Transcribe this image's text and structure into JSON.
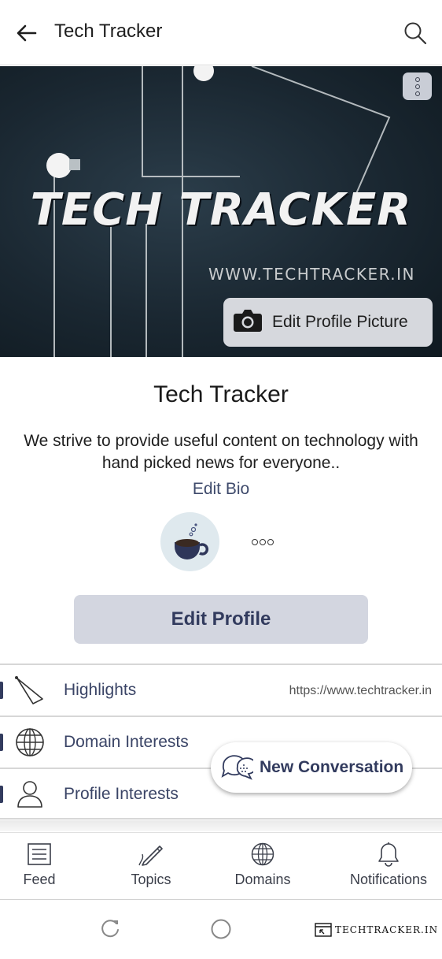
{
  "appbar": {
    "title": "Tech Tracker"
  },
  "banner": {
    "logo_text": "TECH TRACKER",
    "url_text": "WWW.TECHTRACKER.IN",
    "edit_picture_label": "Edit Profile Picture"
  },
  "profile": {
    "name": "Tech Tracker",
    "bio_line1": "We strive to provide useful content on technology with",
    "bio_line2": "hand picked news for everyone..",
    "edit_bio": "Edit Bio",
    "edit_profile": "Edit Profile"
  },
  "list": {
    "highlights": "Highlights",
    "highlights_link": "https://www.techtracker.in",
    "domain_interests": "Domain Interests",
    "profile_interests": "Profile Interests"
  },
  "fab": {
    "label": "New Conversation"
  },
  "bottom_nav": [
    {
      "label": "Feed",
      "icon": "feed-icon"
    },
    {
      "label": "Topics",
      "icon": "pencil-icon"
    },
    {
      "label": "Domains",
      "icon": "globe-icon"
    },
    {
      "label": "Notifications",
      "icon": "bell-icon"
    }
  ],
  "watermark": {
    "text": "TECHTRACKER.IN"
  },
  "colors": {
    "accent": "#323b5e",
    "button_bg": "#d3d6e0",
    "banner_bg": "#1a2731"
  }
}
